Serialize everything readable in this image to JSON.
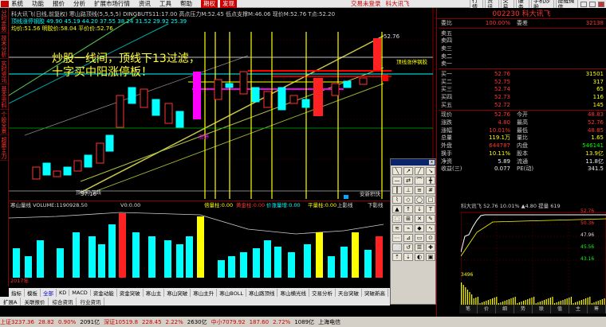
{
  "menu": {
    "items": [
      "系统",
      "功能",
      "报价",
      "分析",
      "扩展市场行情",
      "资讯",
      "工具",
      "帮助"
    ],
    "active1": "期权",
    "active2": "发现",
    "trade_link": "交易未登录",
    "stock_short": "科大讯飞"
  },
  "right_toolbar": [
    "行情",
    "资讯",
    "交易",
    "服务",
    "手机炒股",
    "提醒微信"
  ],
  "left_tabs": [
    "分时走势",
    "技术分析",
    "实时资讯",
    "基本资料",
    "个股全景",
    "超赢主力"
  ],
  "chart_header": {
    "line1": "科大讯飞(日线,前复权)  寒山路顶线(5,5,5,5)   DINGBUTS11:17.00  高点压力M:52.45  低点支撑M:46.06  现价M:52.76  T点:52.20",
    "line2": "顶线涨停钢胶 49.90  45.19  44.20  37.55  38.24  31.52  29.92  25.39",
    "line3": "均价:51.56    明胶价:58.04   平价价:52.76"
  },
  "overlay_text": [
    "炒股一线间，顶线下13过滤，",
    "十字买中阳涨停板！"
  ],
  "chart_labels": {
    "price_top": "52.76",
    "low_label": "37.16",
    "limit_label": "顶线涨停钢胶",
    "flag_label": "涨停",
    "brand": "顶线涨停钢胶",
    "bottom_left": "顶线阳 顶线",
    "bottom_right": "安新积快",
    "sell": "卖出",
    "buy": "买入"
  },
  "ind_header": {
    "name": "寒山量线 VOLUME:1190928.50",
    "v0": "V0:0.00",
    "legend": [
      "倍量柱:0.00",
      "黄金柱:0.00",
      "价涨量增:0.00",
      "平量柱:0.00",
      "上影线",
      "下影线"
    ]
  },
  "ind_year": "2017年",
  "bottom_tabs": [
    "指标",
    "模板",
    "全部",
    "KD",
    "MACD",
    "资金动能",
    "资金突破",
    "寒山主",
    "寒山突破",
    "寒山主升",
    "寒山BOLL",
    "寒山路顶线",
    "寒山横光线",
    "交易分析",
    "天台突破",
    "突破新高",
    "资金"
  ],
  "bottom_tabs2": [
    "扩展A",
    "关联报价",
    "综合资讯",
    "行业资讯"
  ],
  "status": [
    {
      "t": "上证3237.36",
      "c": "r"
    },
    {
      "t": "28.82",
      "c": "r"
    },
    {
      "t": "0.90%",
      "c": "r"
    },
    {
      "t": "2091亿",
      "c": ""
    },
    {
      "t": "深证10519.8",
      "c": "r"
    },
    {
      "t": "228.45",
      "c": "r"
    },
    {
      "t": "2.22%",
      "c": "r"
    },
    {
      "t": "2630亿",
      "c": ""
    },
    {
      "t": "中小7079.92",
      "c": "r"
    },
    {
      "t": "187.60",
      "c": "r"
    },
    {
      "t": "2.72%",
      "c": "r"
    },
    {
      "t": "1089亿",
      "c": ""
    },
    {
      "t": "上海电信",
      "c": ""
    }
  ],
  "stock": {
    "code": "002230",
    "name": "科大讯飞",
    "header": "002230 科大讯飞"
  },
  "quote": {
    "weibi": [
      "委比",
      "100.00%",
      "委差",
      "32138"
    ],
    "sell": [
      [
        "卖五",
        "",
        ""
      ],
      [
        "卖四",
        "",
        ""
      ],
      [
        "卖三",
        "",
        ""
      ],
      [
        "卖二",
        "",
        ""
      ],
      [
        "卖一",
        "",
        ""
      ]
    ],
    "buy": [
      [
        "买一",
        "52.76",
        "31501"
      ],
      [
        "买二",
        "52.75",
        "317"
      ],
      [
        "买三",
        "52.74",
        "65"
      ],
      [
        "买四",
        "52.73",
        "116"
      ],
      [
        "买五",
        "52.72",
        "145"
      ]
    ],
    "info": [
      [
        "现价",
        "52.76",
        "今开",
        "48.83",
        "red",
        "red"
      ],
      [
        "涨跌",
        "4.80",
        "最高",
        "52.76",
        "red",
        "red"
      ],
      [
        "涨幅",
        "10.01%",
        "最低",
        "48.85",
        "red",
        "red"
      ],
      [
        "总量",
        "119.1万",
        "量比",
        "1.65",
        "yellow",
        "yellow"
      ],
      [
        "外盘",
        "644787",
        "内盘",
        "546141",
        "red",
        "green"
      ],
      [
        "换手",
        "10.11%",
        "股本",
        "13.9亿",
        "yellow",
        "yellow"
      ],
      [
        "净资",
        "5.89",
        "流通",
        "11.8亿",
        "white",
        "white"
      ],
      [
        "收益(三)",
        "0.077",
        "PE(动)",
        "341.5",
        "white",
        "white"
      ]
    ]
  },
  "mini": {
    "title": "科大讯飞  52.76  10.01%  ▲4.80  提量 619",
    "prices": [
      "52.76",
      "50.36",
      "47.96",
      "45.56",
      "43.16"
    ],
    "pct": [
      "10.01%",
      "4.95%",
      "0.00%",
      "4.95%",
      "10.01%"
    ],
    "vol": "3496",
    "tabs": [
      "笔",
      "价",
      "细",
      "势",
      "联",
      "值",
      "主",
      "筹"
    ]
  },
  "side_prices": [
    "52.76",
    "50.36",
    "47.96",
    "45.56",
    "43.16"
  ]
}
